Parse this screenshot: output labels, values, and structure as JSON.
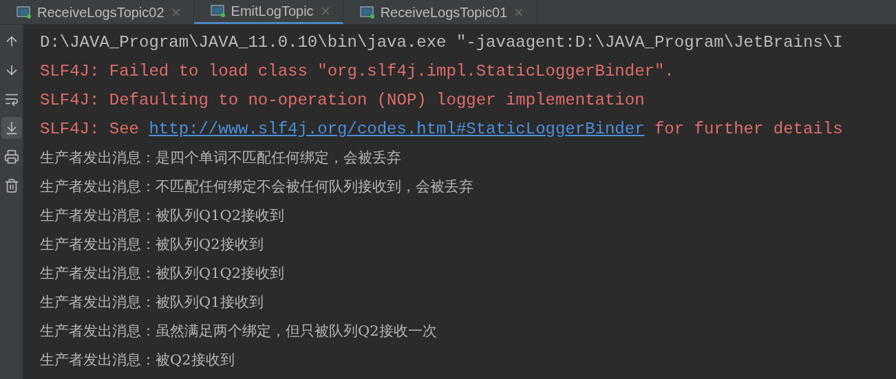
{
  "tabs": [
    {
      "label": "ReceiveLogsTopic02",
      "selected": false
    },
    {
      "label": "EmitLogTopic",
      "selected": true
    },
    {
      "label": "ReceiveLogsTopic01",
      "selected": false
    }
  ],
  "toolbar": [
    {
      "kind": "up",
      "on": false
    },
    {
      "kind": "down",
      "on": false
    },
    {
      "kind": "wrap",
      "on": false
    },
    {
      "kind": "scroll-end",
      "on": true
    },
    {
      "kind": "print",
      "on": false
    },
    {
      "kind": "delete",
      "on": false
    }
  ],
  "console": [
    {
      "segments": [
        {
          "kind": "plain",
          "text": "D:\\JAVA_Program\\JAVA_11.0.10\\bin\\java.exe \"-javaagent:D:\\JAVA_Program\\JetBrains\\I"
        }
      ]
    },
    {
      "segments": [
        {
          "kind": "error",
          "text": "SLF4J: Failed to load class \"org.slf4j.impl.StaticLoggerBinder\"."
        }
      ]
    },
    {
      "segments": [
        {
          "kind": "error",
          "text": "SLF4J: Defaulting to no-operation (NOP) logger implementation"
        }
      ]
    },
    {
      "segments": [
        {
          "kind": "error",
          "text": "SLF4J: See "
        },
        {
          "kind": "link",
          "text": "http://www.slf4j.org/codes.html#StaticLoggerBinder"
        },
        {
          "kind": "error",
          "text": " for further details"
        }
      ]
    },
    {
      "segments": [
        {
          "kind": "output",
          "text": "生产者发出消息：是四个单词不匹配任何绑定，会被丢弃"
        }
      ]
    },
    {
      "segments": [
        {
          "kind": "output",
          "text": "生产者发出消息：不匹配任何绑定不会被任何队列接收到，会被丢弃"
        }
      ]
    },
    {
      "segments": [
        {
          "kind": "output",
          "text": "生产者发出消息：被队列Q1Q2接收到"
        }
      ]
    },
    {
      "segments": [
        {
          "kind": "output",
          "text": "生产者发出消息：被队列Q2接收到"
        }
      ]
    },
    {
      "segments": [
        {
          "kind": "output",
          "text": "生产者发出消息：被队列Q1Q2接收到"
        }
      ]
    },
    {
      "segments": [
        {
          "kind": "output",
          "text": "生产者发出消息：被队列Q1接收到"
        }
      ]
    },
    {
      "segments": [
        {
          "kind": "output",
          "text": "生产者发出消息：虽然满足两个绑定，但只被队列Q2接收一次"
        }
      ]
    },
    {
      "segments": [
        {
          "kind": "output",
          "text": "生产者发出消息：被Q2接收到"
        }
      ]
    }
  ]
}
